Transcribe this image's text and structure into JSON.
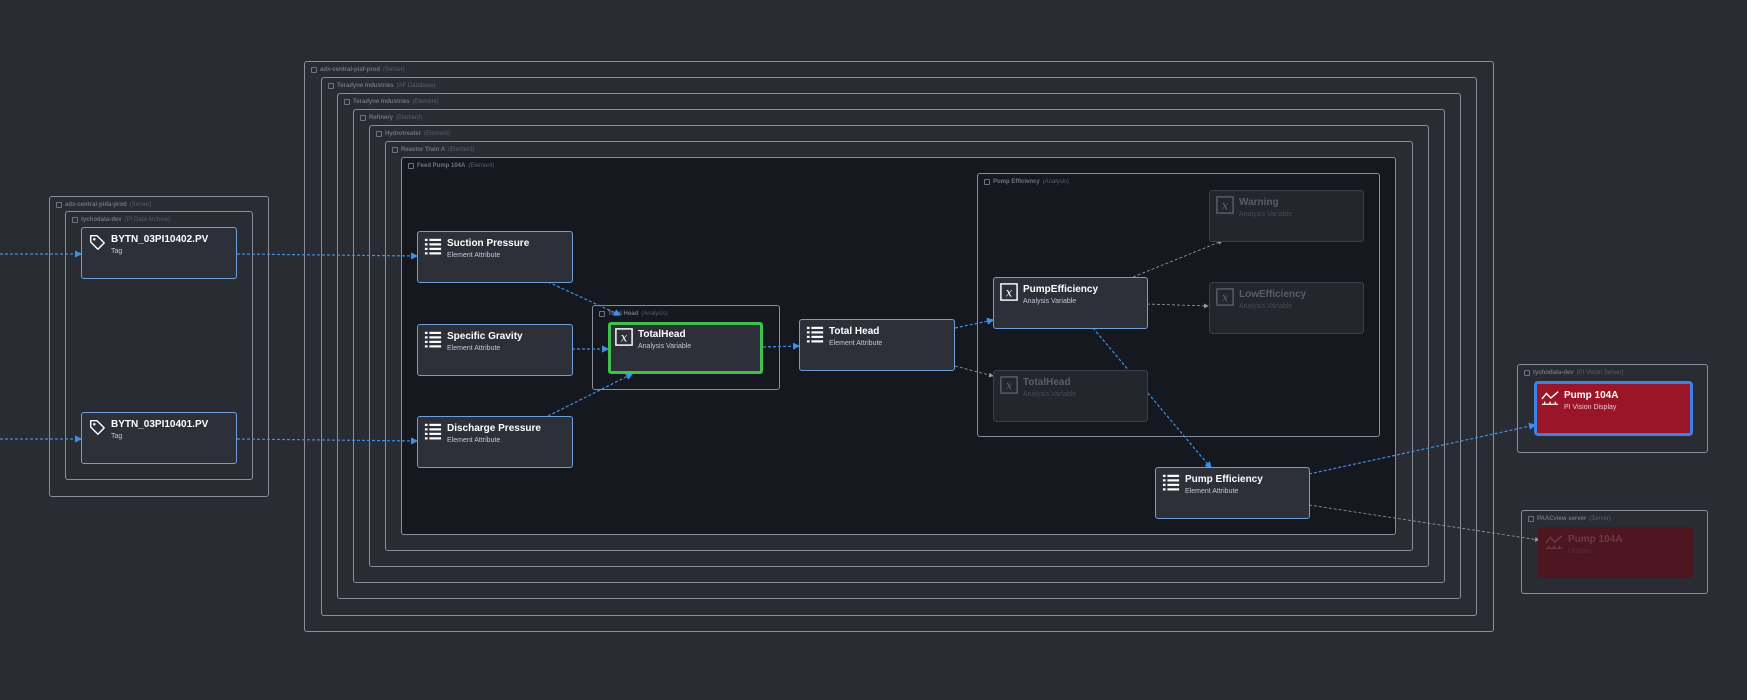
{
  "groups": {
    "adx_central_piaf": {
      "name": "adx-central-piaf-prod",
      "type": "(Server)"
    },
    "teradyne_db": {
      "name": "Teradyne Industries",
      "type": "(AF Database)"
    },
    "teradyne_el": {
      "name": "Teradyne Industries",
      "type": "(Element)"
    },
    "refinery": {
      "name": "Refinery",
      "type": "(Element)"
    },
    "hydrotreater": {
      "name": "Hydrotreater",
      "type": "(Element)"
    },
    "reactor_train": {
      "name": "Reactor Train A",
      "type": "(Element)"
    },
    "feed_pump": {
      "name": "Feed Pump 104A",
      "type": "(Element)"
    },
    "total_head_analysis": {
      "name": "Total Head",
      "type": "(Analysis)"
    },
    "pump_eff_analysis": {
      "name": "Pump Efficiency",
      "type": "(Analysis)"
    },
    "adx_central_pida": {
      "name": "adx-central-pida-prod",
      "type": "(Server)"
    },
    "tychodata_archive": {
      "name": "tychodata-dev",
      "type": "(PI Data Archive)"
    },
    "tychodata_vision": {
      "name": "tychodata-dev",
      "type": "(PI Vision Server)"
    },
    "paacview": {
      "name": "PAACview server",
      "type": "(Server)"
    }
  },
  "nodes": {
    "tag1": {
      "title": "BYTN_03PI10402.PV",
      "subtitle": "Tag",
      "icon": "tag-icon"
    },
    "tag2": {
      "title": "BYTN_03PI10401.PV",
      "subtitle": "Tag",
      "icon": "tag-icon"
    },
    "suction": {
      "title": "Suction Pressure",
      "subtitle": "Element Attribute",
      "icon": "list-icon"
    },
    "gravity": {
      "title": "Specific Gravity",
      "subtitle": "Element Attribute",
      "icon": "list-icon"
    },
    "discharge": {
      "title": "Discharge Pressure",
      "subtitle": "Element Attribute",
      "icon": "list-icon"
    },
    "totalhead_var": {
      "title": "TotalHead",
      "subtitle": "Analysis Variable",
      "icon": "variable-x-icon"
    },
    "totalhead_attr": {
      "title": "Total Head",
      "subtitle": "Element Attribute",
      "icon": "list-icon"
    },
    "pumpeff_var": {
      "title": "PumpEfficiency",
      "subtitle": "Analysis Variable",
      "icon": "variable-x-icon"
    },
    "warning_var": {
      "title": "Warning",
      "subtitle": "Analysis Variable",
      "icon": "variable-x-icon"
    },
    "loweff_var": {
      "title": "LowEfficiency",
      "subtitle": "Analysis Variable",
      "icon": "variable-x-icon"
    },
    "totalhead_ghost": {
      "title": "TotalHead",
      "subtitle": "Analysis Variable",
      "icon": "variable-x-icon"
    },
    "pumpeff_attr": {
      "title": "Pump Efficiency",
      "subtitle": "Element Attribute",
      "icon": "list-icon"
    },
    "pump_display": {
      "title": "Pump 104A",
      "subtitle": "PI Vision Display",
      "icon": "trend-display-icon"
    },
    "pump_display_ghost": {
      "title": "Pump 104A",
      "subtitle": "Display",
      "icon": "trend-display-icon"
    }
  },
  "colors": {
    "background": "#2a2c34",
    "edge_active": "#3b8fe8",
    "edge_inactive": "#9a9ca4",
    "selected": "#3fbf4c",
    "display": "#9b1528"
  }
}
